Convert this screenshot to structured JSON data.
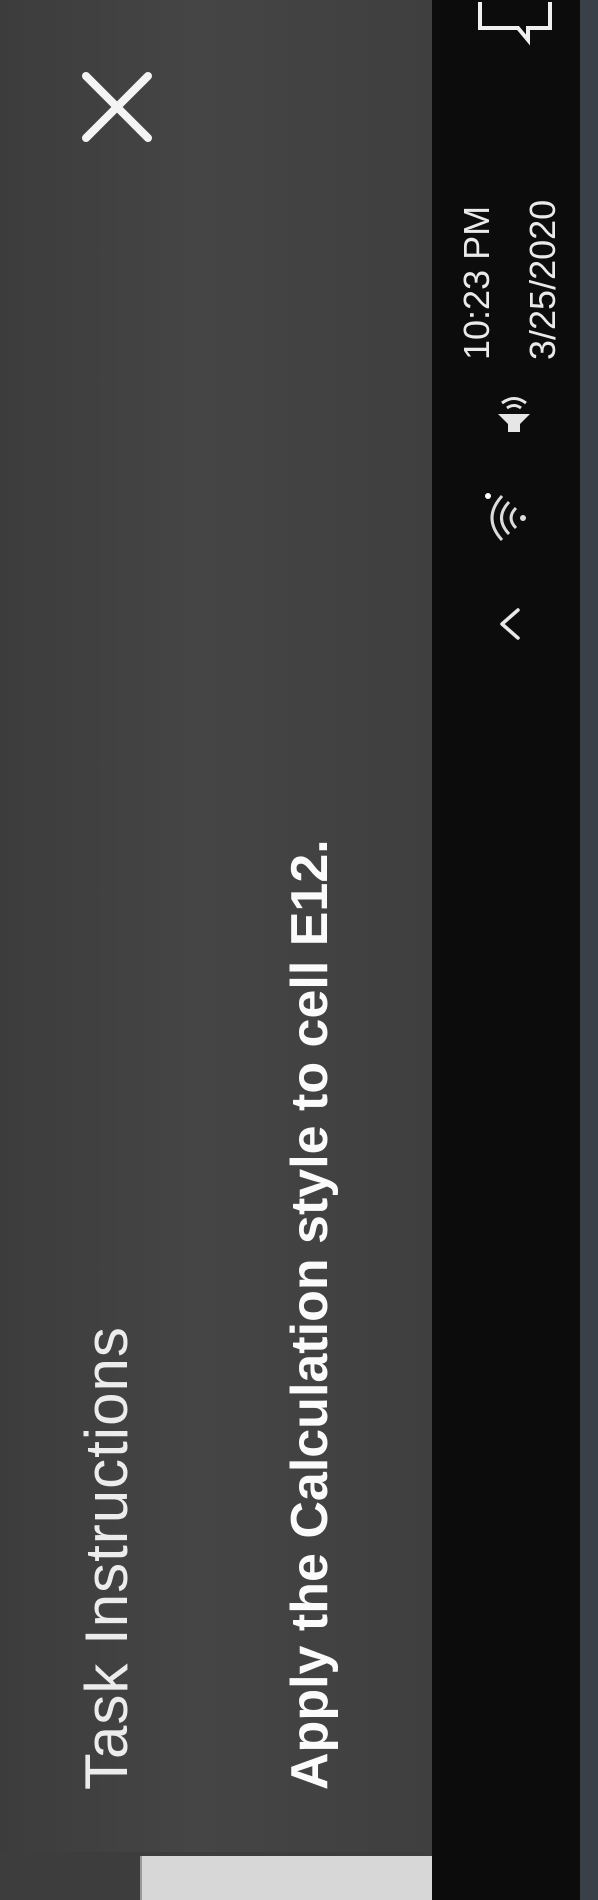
{
  "dialog": {
    "title": "Task Instructions",
    "instruction": "Apply the Calculation style to cell E12.",
    "close_icon": "close-icon"
  },
  "taskbar": {
    "time": "10:23 PM",
    "date": "3/25/2020",
    "icons": [
      "chevron-up-icon",
      "wifi-icon",
      "volume-icon",
      "notification-icon"
    ]
  },
  "colors": {
    "panel": "#454545",
    "taskbar": "#0c0c0c",
    "text": "#f2f2f2"
  }
}
